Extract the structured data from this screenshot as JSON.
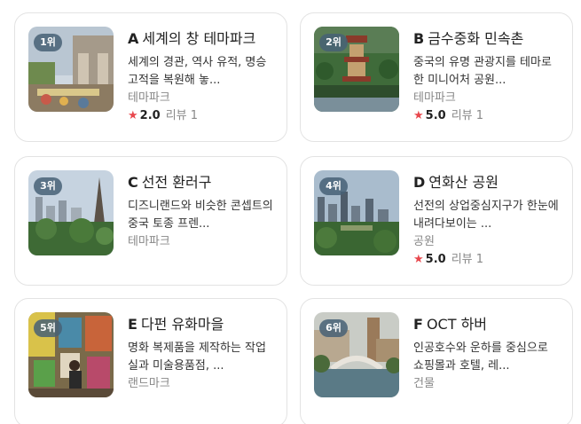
{
  "cards": [
    {
      "rank": "1위",
      "letter": "A",
      "name": "세계의 창 테마파크",
      "desc": "세계의 경관, 역사 유적, 명승 고적을 복원해 놓...",
      "category": "테마파크",
      "score": "2.0",
      "reviews": "리뷰 1"
    },
    {
      "rank": "2위",
      "letter": "B",
      "name": "금수중화 민속촌",
      "desc": "중국의 유명 관광지를 테마로 한 미니어처 공원...",
      "category": "테마파크",
      "score": "5.0",
      "reviews": "리뷰 1"
    },
    {
      "rank": "3위",
      "letter": "C",
      "name": "선전 환러구",
      "desc": "디즈니랜드와 비슷한 콘셉트의 중국 토종 프렌...",
      "category": "테마파크"
    },
    {
      "rank": "4위",
      "letter": "D",
      "name": "연화산 공원",
      "desc": "선전의 상업중심지구가 한눈에 내려다보이는 ...",
      "category": "공원",
      "score": "5.0",
      "reviews": "리뷰 1"
    },
    {
      "rank": "5위",
      "letter": "E",
      "name": "다펀 유화마을",
      "desc": "명화 복제품을 제작하는 작업실과 미술용품점, ...",
      "category": "랜드마크"
    },
    {
      "rank": "6위",
      "letter": "F",
      "name": "OCT 하버",
      "desc": "인공호수와 운하를 중심으로 쇼핑몰과 호텔, 레...",
      "category": "건물"
    }
  ],
  "star_icon": "star-icon",
  "colors": {
    "star": "#e8474d",
    "badge": "#466076",
    "border": "#e3e3e3"
  }
}
